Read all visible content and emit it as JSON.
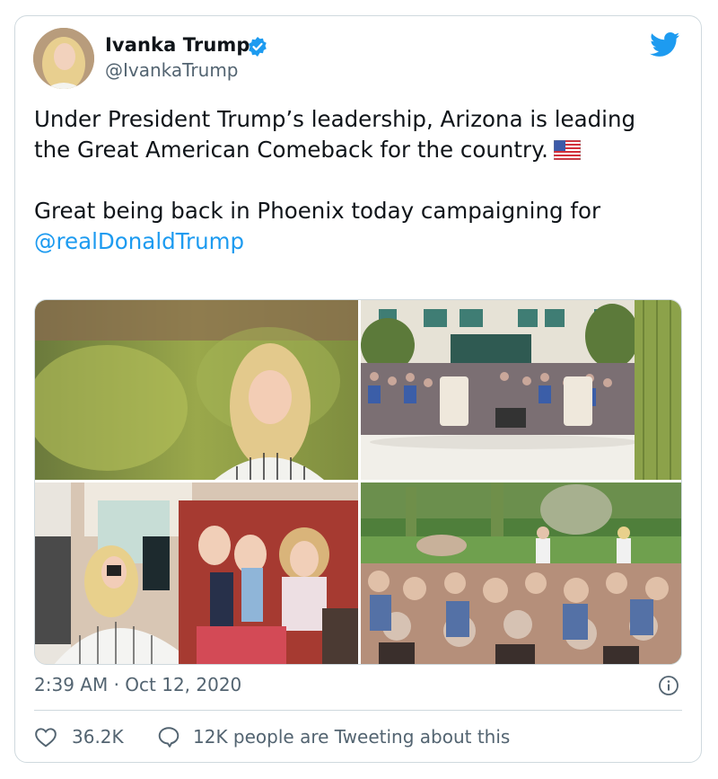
{
  "author": {
    "name": "Ivanka Trump",
    "handle": "@IvankaTrump"
  },
  "tweet": {
    "line1": "Under President Trump’s leadership, Arizona is leading the Great American Comeback for the country.",
    "line2_prefix": "Great being back in Phoenix today campaigning for",
    "mention": "@realDonaldTrump"
  },
  "timestamp": "2:39 AM · Oct 12, 2020",
  "stats": {
    "likes": "36.2K",
    "tweeting": "12K people are Tweeting about this"
  },
  "icons": {
    "verified": "verified-badge-icon",
    "bird": "twitter-bird-icon",
    "flag": "us-flag-emoji",
    "info": "info-icon",
    "like": "heart-icon",
    "reply": "speech-bubble-icon"
  },
  "colors": {
    "accent": "#1d9bf0",
    "secondary_text": "#536471",
    "border": "#cfd9de"
  }
}
